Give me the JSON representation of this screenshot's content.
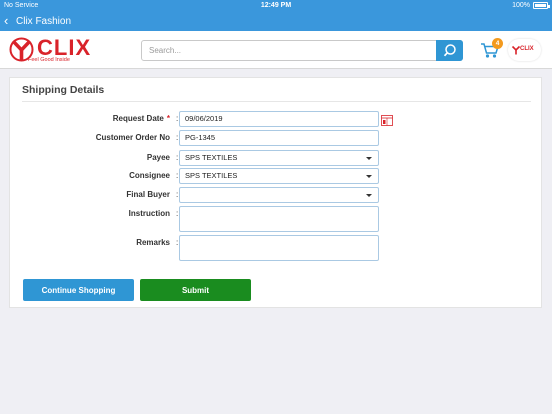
{
  "status_bar": {
    "carrier": "No Service",
    "time": "12:49 PM",
    "battery": "100%"
  },
  "nav": {
    "back_icon": "chevron-left-icon",
    "title": "Clix Fashion"
  },
  "header": {
    "logo_word": "CLIX",
    "logo_tagline": "Feel Good Inside",
    "search_placeholder": "Search...",
    "cart_count": "4",
    "brand_chip": "CLIX",
    "brand_color": "#d9232a",
    "accent_color": "#2f96d4"
  },
  "form": {
    "title": "Shipping Details",
    "fields": {
      "request_date": {
        "label": "Request Date",
        "required_mark": "*",
        "value": "09/06/2019"
      },
      "customer_order_no": {
        "label": "Customer Order No",
        "value": "PG-1345"
      },
      "payee": {
        "label": "Payee",
        "value": "SPS TEXTILES"
      },
      "consignee": {
        "label": "Consignee",
        "value": "SPS TEXTILES"
      },
      "final_buyer": {
        "label": "Final Buyer",
        "value": ""
      },
      "instruction": {
        "label": "Instruction",
        "value": ""
      },
      "remarks": {
        "label": "Remarks",
        "value": ""
      }
    },
    "colon": ":",
    "buttons": {
      "continue": "Continue Shopping",
      "submit": "Submit"
    },
    "submit_color": "#1a8c1f"
  }
}
